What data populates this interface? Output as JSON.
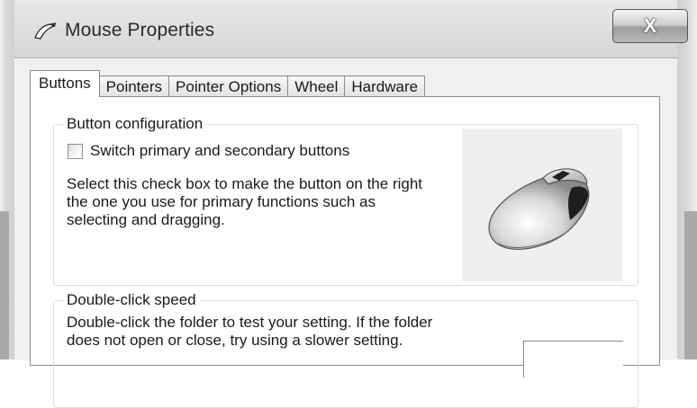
{
  "window": {
    "title": "Mouse Properties",
    "close_label": "X"
  },
  "tabs": [
    {
      "label": "Buttons",
      "active": true
    },
    {
      "label": "Pointers",
      "active": false
    },
    {
      "label": "Pointer Options",
      "active": false
    },
    {
      "label": "Wheel",
      "active": false
    },
    {
      "label": "Hardware",
      "active": false
    }
  ],
  "button_configuration": {
    "group_label": "Button configuration",
    "checkbox_label": "Switch primary and secondary buttons",
    "checkbox_checked": false,
    "description": "Select this check box to make the button on the right\nthe one you use for primary functions such as\nselecting and dragging."
  },
  "double_click": {
    "group_label": "Double-click speed",
    "description": "Double-click the folder to test your setting. If the folder\ndoes not open or close, try using a slower setting."
  },
  "icons": {
    "title": "mouse-pointer-icon",
    "illustration": "mouse-illustration-icon",
    "test_folder": "folder-icon"
  }
}
